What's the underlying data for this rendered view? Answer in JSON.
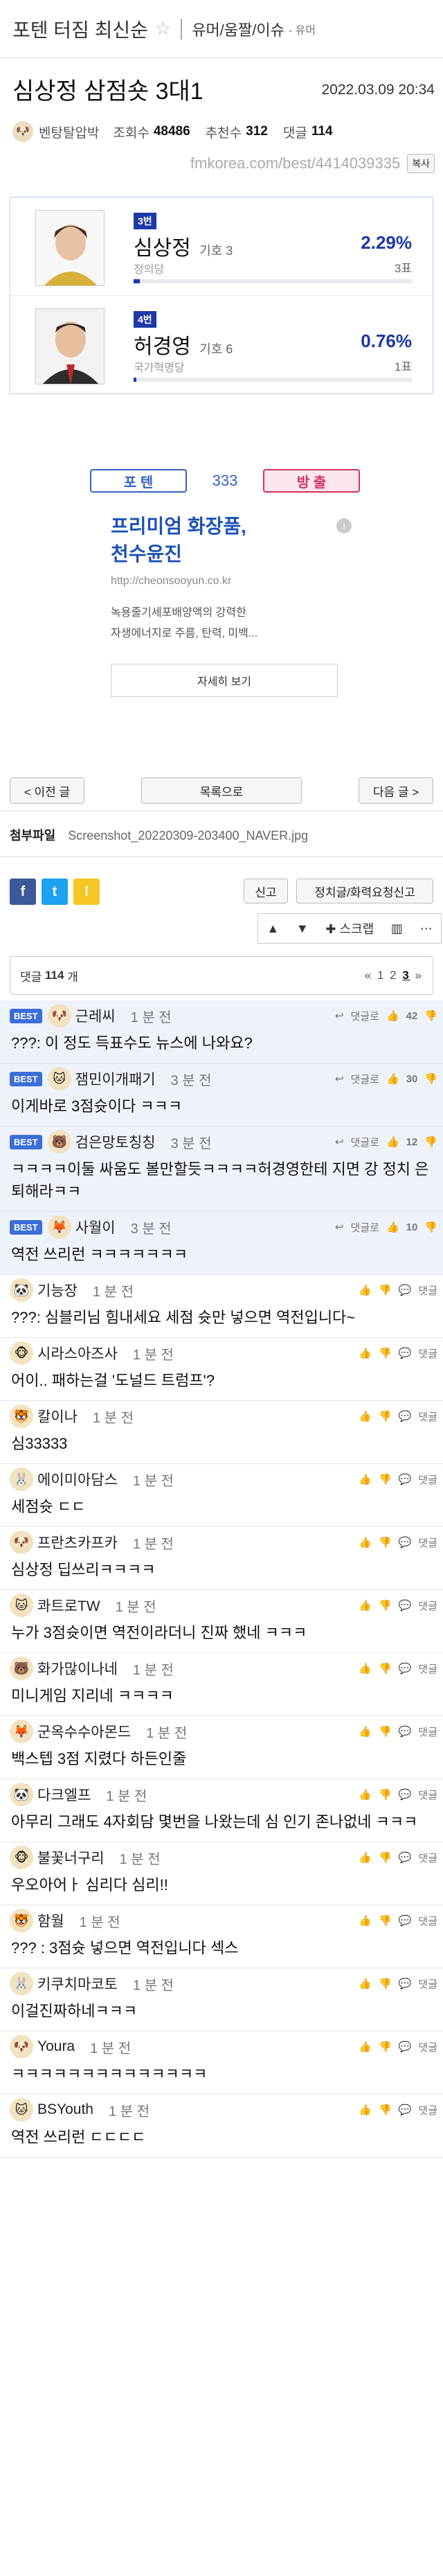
{
  "topbar": {
    "category": "포텐 터짐 최신순",
    "star": "☆",
    "sub": "유머/움짤/이슈",
    "sub2": "- 유머"
  },
  "post": {
    "title": "심상정 삼점숏 3대1",
    "date": "2022.03.09 20:34",
    "author": "벤탕탈압박",
    "views_label": "조회수",
    "views": "48486",
    "recommend_label": "추천수",
    "recommend": "312",
    "comments_label": "댓글",
    "comments": "114",
    "url": "fmkorea.com/best/4414039335",
    "copy_label": "복사"
  },
  "vote": [
    {
      "num": "3번",
      "name": "심상정",
      "code": "기호 3",
      "party": "정의당",
      "pct": "2.29%",
      "count": "3표",
      "share": 0.0229
    },
    {
      "num": "4번",
      "name": "허경영",
      "code": "기호 6",
      "party": "국가혁명당",
      "pct": "0.76%",
      "count": "1표",
      "share": 0.0076
    }
  ],
  "ad": {
    "tag1": "포 텐",
    "tag2": "333",
    "tag3": "방 출",
    "headline1": "프리미엄 화장품,",
    "headline2": "천수윤진",
    "url": "http://cheonsooyun.co.kr",
    "desc1": "녹용줄기세포배양액의 강력한",
    "desc2": "자생에너지로 주름, 탄력, 미백...",
    "button": "자세히 보기"
  },
  "nav": {
    "prev": "< 이전 글",
    "list": "목록으로",
    "next": "다음 글 >"
  },
  "attach": {
    "label": "첨부파일",
    "file": "Screenshot_20220309-203400_NAVER.jpg"
  },
  "buttons": {
    "report": "신고",
    "report2": "정치글/화력요청신고"
  },
  "tools": {
    "up": "▲",
    "down": "▼",
    "scrap": "스크랩"
  },
  "comment_bar": {
    "label": "댓글",
    "count": "114",
    "unit": "개",
    "pager_prev": "«",
    "p1": "1",
    "p2": "2",
    "p3": "3",
    "pager_next": "»"
  },
  "comment_labels": {
    "reply": "댓글로",
    "reply2": "댓글"
  },
  "comments": [
    {
      "best": true,
      "nick": "근레씨",
      "time": "1 분 전",
      "up": "42",
      "text": "???: 이 정도 득표수도 뉴스에 나와요?"
    },
    {
      "best": true,
      "nick": "잼민이개패기",
      "time": "3 분 전",
      "up": "30",
      "text": "이게바로 3점슛이다 ㅋㅋㅋ"
    },
    {
      "best": true,
      "nick": "검은망토칭칭",
      "time": "3 분 전",
      "up": "12",
      "text": "ㅋㅋㅋㅋ이둘 싸움도 볼만할듯ㅋㅋㅋㅋ허경영한테 지면 강 정치 은퇴해라ㅋㅋ"
    },
    {
      "best": true,
      "nick": "사월이",
      "time": "3 분 전",
      "up": "10",
      "text": "역전 쓰리런 ㅋㅋㅋㅋㅋㅋㅋ"
    },
    {
      "best": false,
      "nick": "기능장",
      "time": "1 분 전",
      "up": "",
      "text": "???: 심블리님 힘내세요 세점 슛만 넣으면 역전입니다~"
    },
    {
      "best": false,
      "nick": "시라스아즈사",
      "time": "1 분 전",
      "up": "",
      "text": "어이.. 패하는걸 '도널드 트럼프'?"
    },
    {
      "best": false,
      "nick": "칼이나",
      "time": "1 분 전",
      "up": "",
      "text": "심33333"
    },
    {
      "best": false,
      "nick": "에이미아담스",
      "time": "1 분 전",
      "up": "",
      "text": "세점슛 ㄷㄷ"
    },
    {
      "best": false,
      "nick": "프란츠카프카",
      "time": "1 분 전",
      "up": "",
      "text": "심상정 딥쓰리ㅋㅋㅋㅋ"
    },
    {
      "best": false,
      "nick": "콰트로TW",
      "time": "1 분 전",
      "up": "",
      "text": "누가 3점슛이면 역전이라더니 진짜 했네 ㅋㅋㅋ"
    },
    {
      "best": false,
      "nick": "화가많이나네",
      "time": "1 분 전",
      "up": "",
      "text": "미니게임 지리네 ㅋㅋㅋㅋ"
    },
    {
      "best": false,
      "nick": "군옥수수아몬드",
      "time": "1 분 전",
      "up": "",
      "text": "백스텝 3점 지렸다 하든인줄"
    },
    {
      "best": false,
      "nick": "다크엘프",
      "time": "1 분 전",
      "up": "",
      "text": "아무리 그래도 4자회담 몇번을 나왔는데 심 인기 존나없네 ㅋㅋㅋ"
    },
    {
      "best": false,
      "nick": "불꽃너구리",
      "time": "1 분 전",
      "up": "",
      "text": "우오아어ㅏ 심리다 심리!!"
    },
    {
      "best": false,
      "nick": "함월",
      "time": "1 분 전",
      "up": "",
      "text": "??? : 3점슛 넣으면 역전입니다 섹스"
    },
    {
      "best": false,
      "nick": "키쿠치마코토",
      "time": "1 분 전",
      "up": "",
      "text": "이걸진짜하네ㅋㅋㅋ"
    },
    {
      "best": false,
      "nick": "Youra",
      "time": "1 분 전",
      "up": "",
      "text": "ㅋㅋㅋㅋㅋㅋㅋㅋㅋㅋㅋㅋㅋㅋ"
    },
    {
      "best": false,
      "nick": "BSYouth",
      "time": "1 분 전",
      "up": "",
      "text": "역전 쓰리런 ㄷㄷㄷㄷ"
    }
  ]
}
